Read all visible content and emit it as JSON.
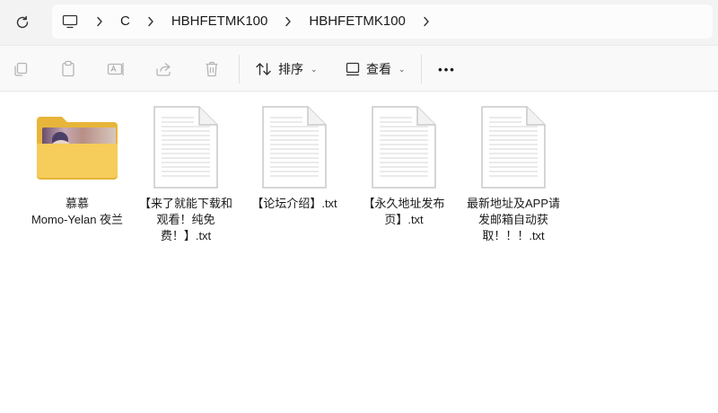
{
  "address": {
    "breadcrumbs": [
      "C",
      "HBHFETMK100",
      "HBHFETMK100"
    ]
  },
  "commandbar": {
    "sort_label": "排序",
    "view_label": "查看",
    "more_label": "•••"
  },
  "files": [
    {
      "name": "慕慕\nMomo-Yelan 夜兰",
      "kind": "folder"
    },
    {
      "name": "【来了就能下载和观看！纯免费！】.txt",
      "kind": "txt"
    },
    {
      "name": "【论坛介绍】.txt",
      "kind": "txt"
    },
    {
      "name": "【永久地址发布页】.txt",
      "kind": "txt"
    },
    {
      "name": "最新地址及APP请发邮箱自动获取！！！.txt",
      "kind": "txt"
    }
  ],
  "colors": {
    "folder_back": "#e7b53a",
    "folder_front": "#f6cc5a",
    "accent": "#0067c0"
  }
}
